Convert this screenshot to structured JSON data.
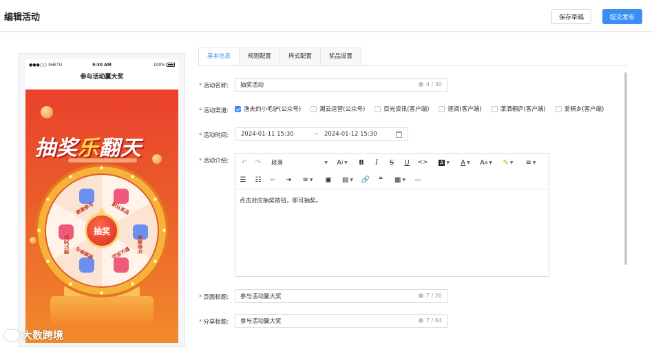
{
  "header": {
    "title": "编辑活动",
    "draft_button": "保存草稿",
    "publish_button": "提交发布"
  },
  "phone": {
    "carrier": "●●●○○ SHETU ",
    "time": "9:30 AM",
    "battery": "100%",
    "page_title": "参与活动赢大奖",
    "headline_a": "抽奖",
    "headline_b": "乐",
    "headline_c": "翻天",
    "wheel_center": "抽奖",
    "segments": [
      "谢谢参与",
      "默认奖品",
      "谢谢参与",
      "默认奖品",
      "谢谢参与",
      "默认奖品"
    ]
  },
  "tabs": [
    {
      "label": "基本信息",
      "active": true
    },
    {
      "label": "规则配置",
      "active": false
    },
    {
      "label": "样式配置",
      "active": false
    },
    {
      "label": "奖品设置",
      "active": false
    }
  ],
  "form": {
    "name": {
      "label": "活动名称:",
      "value": "抽奖活动",
      "count": "4 / 30"
    },
    "channel": {
      "label": "活动渠道:",
      "options": [
        {
          "label": "渔夫的小毛驴(公众号)",
          "checked": true
        },
        {
          "label": "潮云运营(公众号)",
          "checked": false
        },
        {
          "label": "目光资讯(客户端)",
          "checked": false
        },
        {
          "label": "逐阅(客户端)",
          "checked": false
        },
        {
          "label": "潇洒桐庐(客户端)",
          "checked": false
        },
        {
          "label": "爱桐乡(客户端)",
          "checked": false
        }
      ]
    },
    "time": {
      "label": "活动时间:",
      "start": "2024-01-11 15:30",
      "separator": "→",
      "end": "2024-01-12 15:30"
    },
    "intro": {
      "label": "活动介绍:",
      "paragraph_select": "段落",
      "content": "点击对应抽奖按钮，即可抽奖。"
    },
    "page_title": {
      "label": "页面标题:",
      "value": "参与活动赢大奖",
      "count": "7 / 20"
    },
    "share_title": {
      "label": "分享标题:",
      "value": "参与活动赢大奖",
      "count": "7 / 64"
    }
  },
  "watermark": "大数跨境",
  "colors": {
    "accent": "#3a8ef6",
    "required": "#e34d4d",
    "poster_red": "#e9412d"
  }
}
